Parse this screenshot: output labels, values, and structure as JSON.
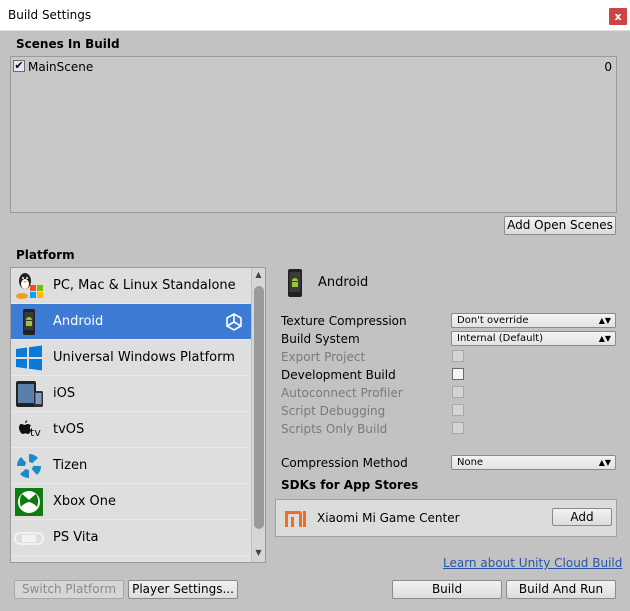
{
  "window": {
    "title": "Build Settings",
    "close_glyph": "x"
  },
  "scenes": {
    "label": "Scenes In Build",
    "items": [
      {
        "name": "MainScene",
        "index": "0",
        "checked": true
      }
    ],
    "add_open_scenes_label": "Add Open Scenes"
  },
  "platform": {
    "label": "Platform",
    "items": [
      {
        "label": "PC, Mac & Linux Standalone",
        "icon": "pc-mac-linux-icon"
      },
      {
        "label": "Android",
        "icon": "android-icon",
        "selected": true,
        "active_badge": "unity-logo-icon"
      },
      {
        "label": "Universal Windows Platform",
        "icon": "windows-logo-icon"
      },
      {
        "label": "iOS",
        "icon": "ios-device-icon"
      },
      {
        "label": "tvOS",
        "icon": "apple-tv-icon"
      },
      {
        "label": "Tizen",
        "icon": "tizen-icon"
      },
      {
        "label": "Xbox One",
        "icon": "xbox-icon"
      },
      {
        "label": "PS Vita",
        "icon": "ps-vita-icon"
      }
    ]
  },
  "settings": {
    "platform_name": "Android",
    "texture_compression": {
      "label": "Texture Compression",
      "value": "Don't override"
    },
    "build_system": {
      "label": "Build System",
      "value": "Internal (Default)"
    },
    "export_project": {
      "label": "Export Project",
      "enabled": false
    },
    "development_build": {
      "label": "Development Build",
      "enabled": true
    },
    "autoconnect_profiler": {
      "label": "Autoconnect Profiler",
      "enabled": false
    },
    "script_debugging": {
      "label": "Script Debugging",
      "enabled": false
    },
    "scripts_only_build": {
      "label": "Scripts Only Build",
      "enabled": false
    },
    "compression_method": {
      "label": "Compression Method",
      "value": "None"
    },
    "sdks_label": "SDKs for App Stores",
    "sdk": {
      "name": "Xiaomi Mi Game Center",
      "add_label": "Add"
    },
    "cloud_link": "Learn about Unity Cloud Build"
  },
  "footer": {
    "switch_platform": "Switch Platform",
    "player_settings": "Player Settings...",
    "build": "Build",
    "build_and_run": "Build And Run"
  },
  "colors": {
    "selection": "#3d7bd4",
    "window_bg": "#c2c2c2",
    "link": "#2a55a7"
  }
}
